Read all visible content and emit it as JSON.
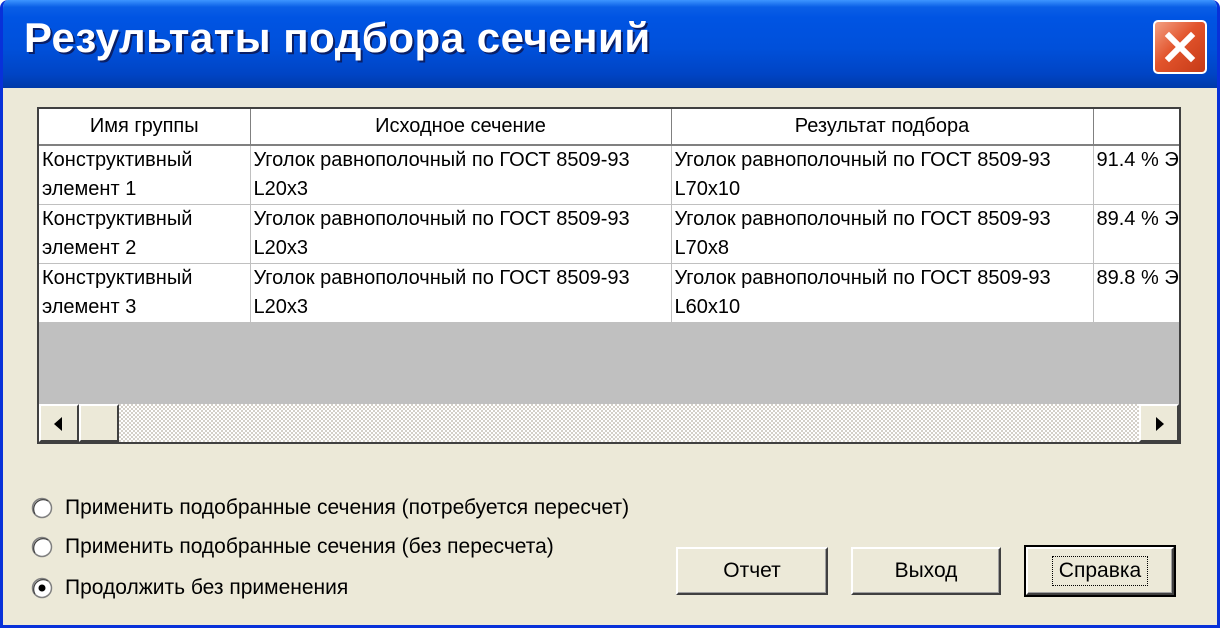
{
  "window": {
    "title": "Результаты подбора сечений"
  },
  "table": {
    "columns": [
      "Имя группы",
      "Исходное сечение",
      "Результат подбора",
      ""
    ],
    "rows": [
      {
        "group": [
          "Конструктивный",
          "элемент  1"
        ],
        "source": [
          "Уголок равнополочный по ГОСТ 8509-93",
          "L20x3"
        ],
        "result": [
          "Уголок равнополочный по ГОСТ 8509-93",
          "L70x10"
        ],
        "extra": "91.4 % Э"
      },
      {
        "group": [
          "Конструктивный",
          "элемент  2"
        ],
        "source": [
          "Уголок равнополочный по ГОСТ 8509-93",
          "L20x3"
        ],
        "result": [
          "Уголок равнополочный по ГОСТ 8509-93",
          "L70x8"
        ],
        "extra": "89.4 % Э"
      },
      {
        "group": [
          "Конструктивный",
          "элемент  3"
        ],
        "source": [
          "Уголок равнополочный по ГОСТ 8509-93",
          "L20x3"
        ],
        "result": [
          "Уголок равнополочный по ГОСТ 8509-93",
          "L60x10"
        ],
        "extra": "89.8 % Э"
      }
    ]
  },
  "options": [
    {
      "label": "Применить подобранные сечения (потребуется пересчет)",
      "selected": false
    },
    {
      "label": "Применить подобранные сечения (без пересчета)",
      "selected": false
    },
    {
      "label": "Продолжить без применения",
      "selected": true
    }
  ],
  "buttons": {
    "report": "Отчет",
    "exit": "Выход",
    "help": "Справка"
  },
  "icons": {
    "close": "close-icon",
    "scroll_left": "arrow-left-icon",
    "scroll_right": "arrow-right-icon"
  },
  "colors": {
    "titlebar": "#0054e3",
    "close_button": "#e2542c",
    "dialog_background": "#ece9d8"
  }
}
